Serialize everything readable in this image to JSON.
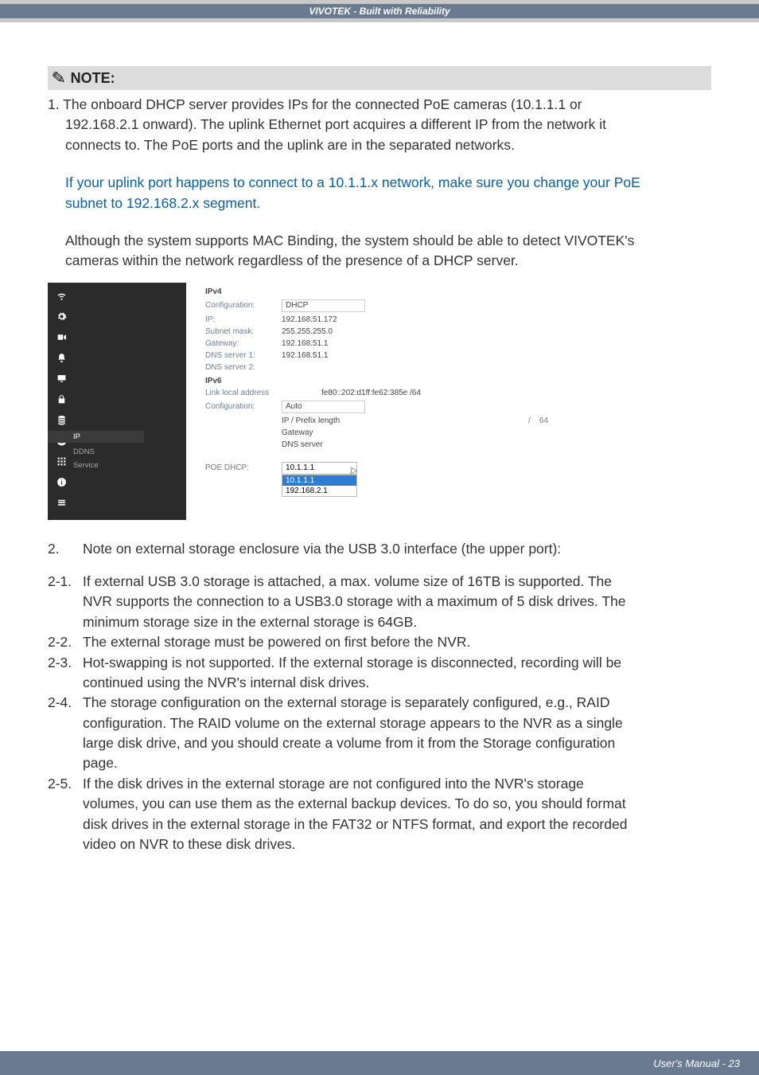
{
  "header": {
    "title": "VIVOTEK - Built with Reliability"
  },
  "note": {
    "label": "NOTE:"
  },
  "para1_lead": "1. The onboard DHCP server provides IPs for the connected PoE cameras (10.1.1.1 or",
  "para1_line2": "192.168.2.1 onward). The uplink Ethernet port acquires a different IP from the network it",
  "para1_line3": "connects to. The PoE ports and the uplink are in the separated networks.",
  "para2_line1": "If your uplink port happens to connect to a 10.1.1.x network, make sure you change your PoE",
  "para2_line2": "subnet to 192.168.2.x segment.",
  "para3_line1": "Although the system supports MAC Binding, the system should be able to detect VIVOTEK's",
  "para3_line2": "cameras within the network regardless of the presence of a DHCP server.",
  "shot": {
    "sidebar": {
      "ip": "IP",
      "ddns": "DDNS",
      "service": "Service"
    },
    "ipv4": {
      "heading": "IPv4",
      "config_label": "Configuration:",
      "config_value": "DHCP",
      "ip_label": "IP:",
      "ip_value": "192.168.51.172",
      "mask_label": "Subnet mask:",
      "mask_value": "255.255.255.0",
      "gw_label": "Gateway:",
      "gw_value": "192.168.51.1",
      "dns1_label": "DNS server 1:",
      "dns1_value": "192.168.51.1",
      "dns2_label": "DNS server 2:"
    },
    "ipv6": {
      "heading": "IPv6",
      "lla_label": "Link local address",
      "lla_value": "fe80::202:d1ff:fe62:385e /64",
      "config_label": "Configuration:",
      "config_value": "Auto",
      "prefix_label": "IP / Prefix length",
      "prefix_slash": "/",
      "prefix_len": "64",
      "gw_label": "Gateway",
      "dns_label": "DNS server"
    },
    "poe": {
      "label": "POE DHCP:",
      "selected": "10.1.1.1",
      "opt1": "10.1.1.1",
      "opt2": "192.168.2.1"
    }
  },
  "notes2": {
    "n2": "Note on external storage enclosure via the USB 3.0 interface (the upper port):",
    "n21a": "If external USB 3.0 storage is attached, a max. volume size of 16TB is supported. The",
    "n21b": "NVR supports the connection to a USB3.0 storage with a maximum of 5 disk drives. The",
    "n21c": "minimum storage size in the external storage is 64GB.",
    "n22": "The external storage must be powered on first before the NVR.",
    "n23a": "Hot-swapping is not supported. If the external storage is disconnected, recording will be",
    "n23b": "continued using the NVR's internal disk drives.",
    "n24a": "The storage configuration on the external storage is separately configured, e.g., RAID",
    "n24b": "configuration. The RAID volume on the external storage appears to the NVR as a single",
    "n24c": "large disk drive, and you should create a volume from it from the Storage configuration",
    "n24d": "page.",
    "n25a": "If the disk drives in the external storage are not configured into the NVR's storage",
    "n25b": "volumes, you can use them as the external backup devices. To do so, you should format",
    "n25c": "disk drives in the external storage in the FAT32 or NTFS format, and export the recorded",
    "n25d": "video on NVR to these disk drives."
  },
  "footer": {
    "text": "User's Manual - 23"
  }
}
